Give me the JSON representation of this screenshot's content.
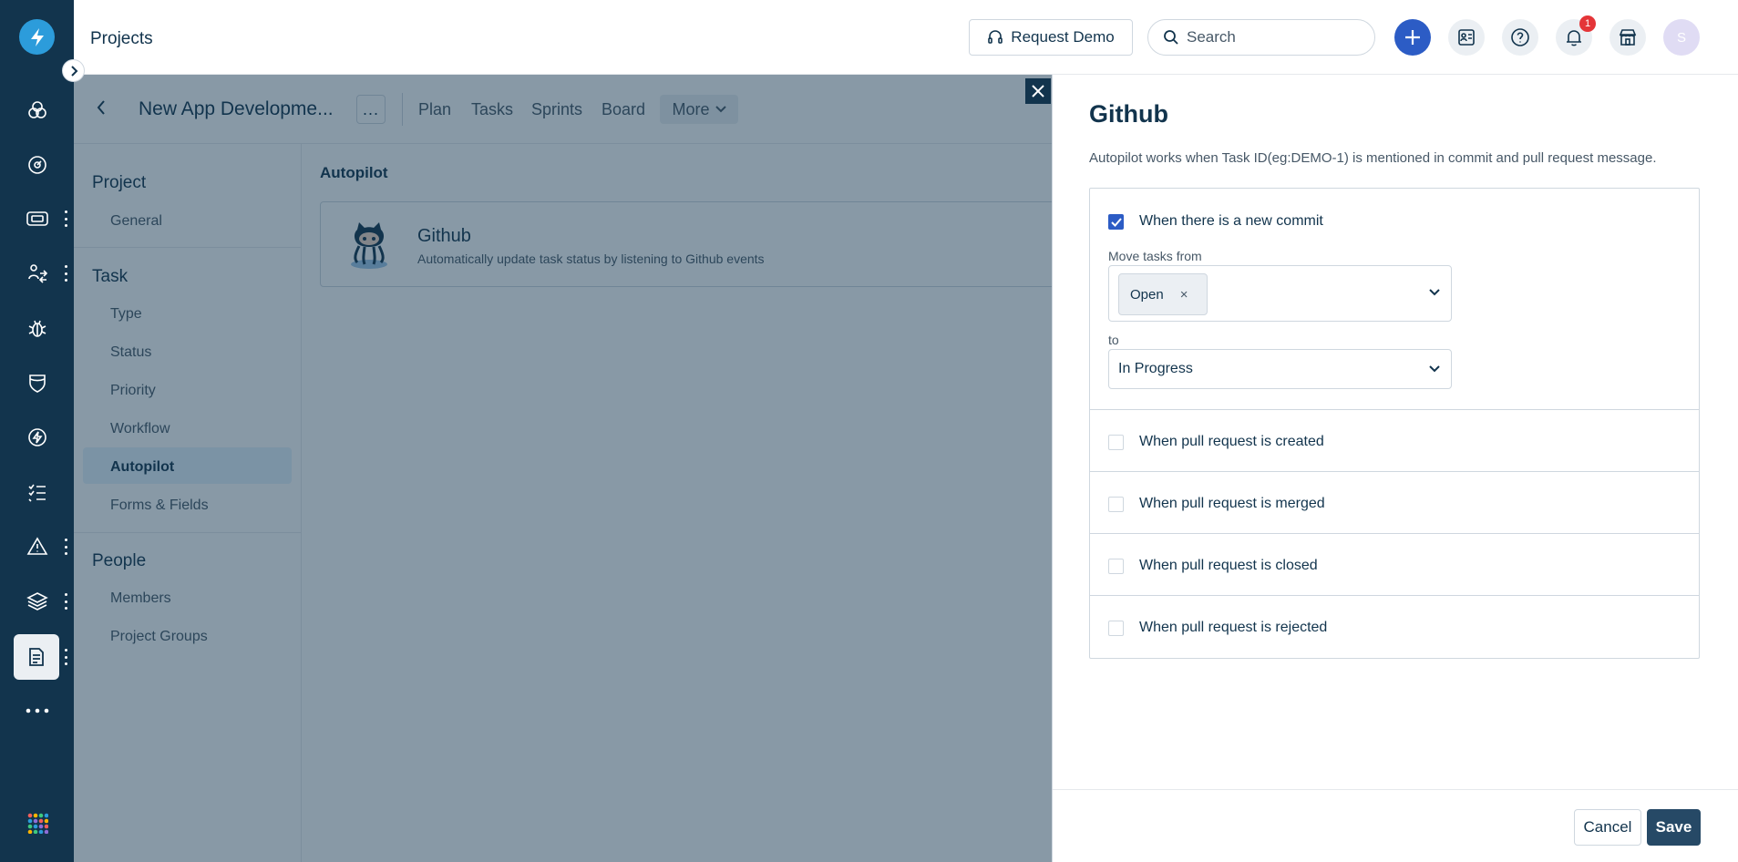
{
  "header": {
    "title": "Projects",
    "request_demo_label": "Request Demo",
    "search_placeholder": "Search",
    "notification_count": "1",
    "avatar_initial": "S"
  },
  "rail": {
    "icons": [
      "logo-bolt-icon",
      "goals-icon",
      "dashboard-icon",
      "ticket-icon",
      "change-icon",
      "bug-icon",
      "shield-icon",
      "release-icon",
      "tasks-icon",
      "alert-icon",
      "layers-icon",
      "document-icon",
      "more-icon",
      "apps-icon"
    ]
  },
  "project_bar": {
    "project_name": "New App Developme...",
    "more_dots": "...",
    "tabs": [
      "Plan",
      "Tasks",
      "Sprints",
      "Board"
    ],
    "more_label": "More"
  },
  "settings_nav": {
    "sections": [
      {
        "title": "Project",
        "items": [
          "General"
        ]
      },
      {
        "title": "Task",
        "items": [
          "Type",
          "Status",
          "Priority",
          "Workflow",
          "Autopilot",
          "Forms & Fields"
        ]
      },
      {
        "title": "People",
        "items": [
          "Members",
          "Project Groups"
        ]
      }
    ],
    "active_item": "Autopilot"
  },
  "content": {
    "heading": "Autopilot",
    "card": {
      "name": "Github",
      "description": "Automatically update task status by listening to Github events"
    }
  },
  "drawer": {
    "title": "Github",
    "subtitle": "Autopilot works when Task ID(eg:DEMO-1) is mentioned in commit and pull request message.",
    "rules": [
      {
        "label": "When there is a new commit",
        "checked": true
      },
      {
        "label": "When pull request is created",
        "checked": false
      },
      {
        "label": "When pull request is merged",
        "checked": false
      },
      {
        "label": "When pull request is closed",
        "checked": false
      },
      {
        "label": "When pull request is rejected",
        "checked": false
      }
    ],
    "move_from_label": "Move tasks from",
    "move_from_chip": "Open",
    "chip_remove": "×",
    "to_label": "to",
    "to_value": "In Progress",
    "cancel_label": "Cancel",
    "save_label": "Save"
  },
  "colors": {
    "rail_bg": "#12344d",
    "primary": "#2c5cc5",
    "save_bg": "#264966",
    "overlay": "rgba(18,52,77,0.5)"
  }
}
